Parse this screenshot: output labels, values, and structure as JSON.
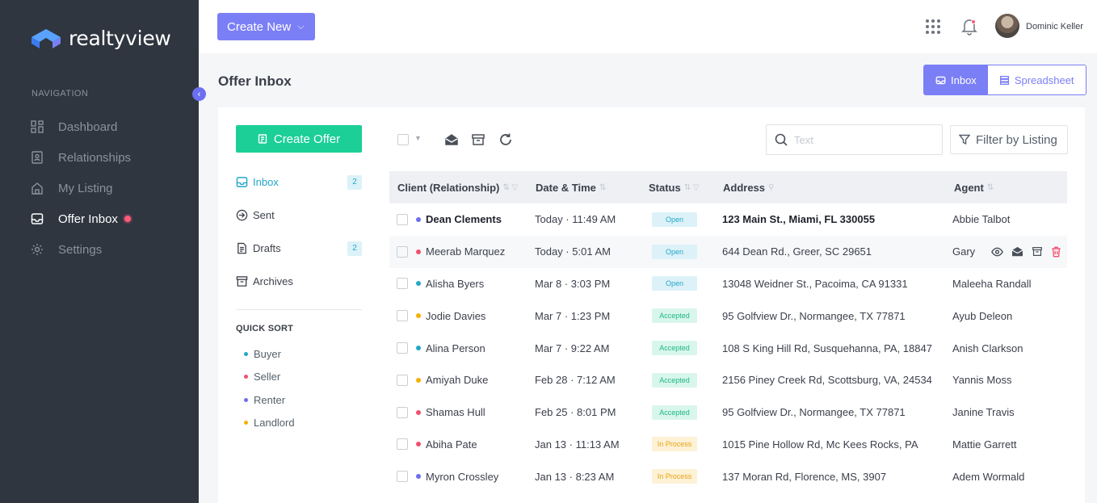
{
  "app": {
    "logo_text": "realtyview"
  },
  "sidebar": {
    "heading": "NAVIGATION",
    "items": [
      {
        "label": "Dashboard",
        "icon": "dashboard-icon",
        "active": false
      },
      {
        "label": "Relationships",
        "icon": "contacts-icon",
        "active": false
      },
      {
        "label": "My Listing",
        "icon": "home-icon",
        "active": false
      },
      {
        "label": "Offer Inbox",
        "icon": "inbox-icon",
        "active": true
      },
      {
        "label": "Settings",
        "icon": "gear-icon",
        "active": false
      }
    ]
  },
  "topbar": {
    "create_new_label": "Create New",
    "user_name": "Dominic Keller"
  },
  "page": {
    "title": "Offer Inbox",
    "view_tabs": [
      {
        "label": "Inbox",
        "active": true
      },
      {
        "label": "Spreadsheet",
        "active": false
      }
    ]
  },
  "left_panel": {
    "create_offer_label": "Create Offer",
    "folders": [
      {
        "label": "Inbox",
        "count": "2",
        "active": true
      },
      {
        "label": "Sent",
        "count": ""
      },
      {
        "label": "Drafts",
        "count": "2"
      },
      {
        "label": "Archives",
        "count": ""
      }
    ],
    "quick_sort_heading": "QUICK SORT",
    "quick_sort": [
      {
        "label": "Buyer",
        "color": "#23a7c9"
      },
      {
        "label": "Seller",
        "color": "#f0506e"
      },
      {
        "label": "Renter",
        "color": "#6c6ff0"
      },
      {
        "label": "Landlord",
        "color": "#f5b000"
      }
    ]
  },
  "toolbar": {
    "search_placeholder": "Text",
    "filter_label": "Filter by Listing"
  },
  "table": {
    "columns": [
      "Client (Relationship)",
      "Date & Time",
      "Status",
      "Address",
      "Agent"
    ],
    "rows": [
      {
        "client": "Dean Clements",
        "color": "#6c6ff0",
        "date": "Today · 11:49 AM",
        "status": "Open",
        "address": "123 Main St., Miami, FL 330055",
        "agent": "Abbie Talbot",
        "unread": true
      },
      {
        "client": "Meerab Marquez",
        "color": "#f0506e",
        "date": "Today · 5:01 AM",
        "status": "Open",
        "address": "644 Dean Rd., Greer, SC 29651",
        "agent": "Gary",
        "hover": true
      },
      {
        "client": "Alisha Byers",
        "color": "#23a7c9",
        "date": "Mar 8 · 3:03 PM",
        "status": "Open",
        "address": "13048 Weidner St., Pacoima, CA 91331",
        "agent": "Maleeha Randall"
      },
      {
        "client": "Jodie Davies",
        "color": "#f5b000",
        "date": "Mar 7 · 1:23 PM",
        "status": "Accepted",
        "address": "95 Golfview Dr., Normangee, TX 77871",
        "agent": "Ayub Deleon"
      },
      {
        "client": "Alina Person",
        "color": "#23a7c9",
        "date": "Mar 7 · 9:22 AM",
        "status": "Accepted",
        "address": "108 S King Hill Rd, Susquehanna, PA, 18847",
        "agent": "Anish Clarkson"
      },
      {
        "client": "Amiyah Duke",
        "color": "#f5b000",
        "date": "Feb 28 · 7:12 AM",
        "status": "Accepted",
        "address": "2156 Piney Creek Rd, Scottsburg, VA, 24534",
        "agent": "Yannis Moss"
      },
      {
        "client": "Shamas Hull",
        "color": "#f0506e",
        "date": "Feb 25 · 8:01 PM",
        "status": "Accepted",
        "address": "95 Golfview Dr., Normangee, TX 77871",
        "agent": "Janine Travis"
      },
      {
        "client": "Abiha Pate",
        "color": "#f0506e",
        "date": "Jan 13 · 11:13 AM",
        "status": "In Process",
        "address": "1015 Pine Hollow Rd, Mc Kees Rocks, PA",
        "agent": "Mattie Garrett"
      },
      {
        "client": "Myron Crossley",
        "color": "#6c6ff0",
        "date": "Jan 13 · 8:23 AM",
        "status": "In Process",
        "address": "137 Moran Rd, Florence, MS, 3907",
        "agent": "Adem Wormald"
      }
    ]
  }
}
